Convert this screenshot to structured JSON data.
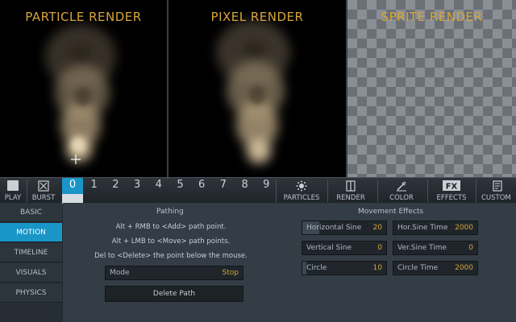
{
  "panels": {
    "particle": "PARTICLE RENDER",
    "pixel": "PIXEL RENDER",
    "sprite": "SPRITE RENDER"
  },
  "toolbar": {
    "play": "PLAY",
    "burst": "BURST",
    "frames": [
      "0",
      "1",
      "2",
      "3",
      "4",
      "5",
      "6",
      "7",
      "8",
      "9"
    ],
    "active_frame": "0",
    "tools": {
      "particles": "PARTICLES",
      "render": "RENDER",
      "color": "COLOR",
      "effects": "EFFECTS",
      "custom": "CUSTOM"
    }
  },
  "sidebar": {
    "items": [
      "BASIC",
      "MOTION",
      "TIMELINE",
      "VISUALS",
      "PHYSICS"
    ],
    "active": "MOTION"
  },
  "pathing": {
    "title": "Pathing",
    "hints": [
      "Alt + RMB to <Add> path point.",
      "Alt + LMB to <Move> path points.",
      "Del to <Delete> the point below the mouse."
    ],
    "mode_label": "Mode",
    "mode_value": "Stop",
    "delete_label": "Delete Path"
  },
  "movement": {
    "title": "Movement Effects",
    "fields": {
      "horizontal_sine": {
        "label": "Horizontal Sine",
        "value": "20",
        "fill": 0.2
      },
      "hor_sine_time": {
        "label": "Hor.Sine Time",
        "value": "2000",
        "fill": 0.0
      },
      "vertical_sine": {
        "label": "Vertical Sine",
        "value": "0",
        "fill": 0.0
      },
      "ver_sine_time": {
        "label": "Ver.Sine Time",
        "value": "0",
        "fill": 0.0
      },
      "circle": {
        "label": "Circle",
        "value": "10",
        "fill": 0.05
      },
      "circle_time": {
        "label": "Circle Time",
        "value": "2000",
        "fill": 0.0
      }
    }
  },
  "colors": {
    "accent": "#1a95c7",
    "title_gold": "#d6a53a"
  }
}
